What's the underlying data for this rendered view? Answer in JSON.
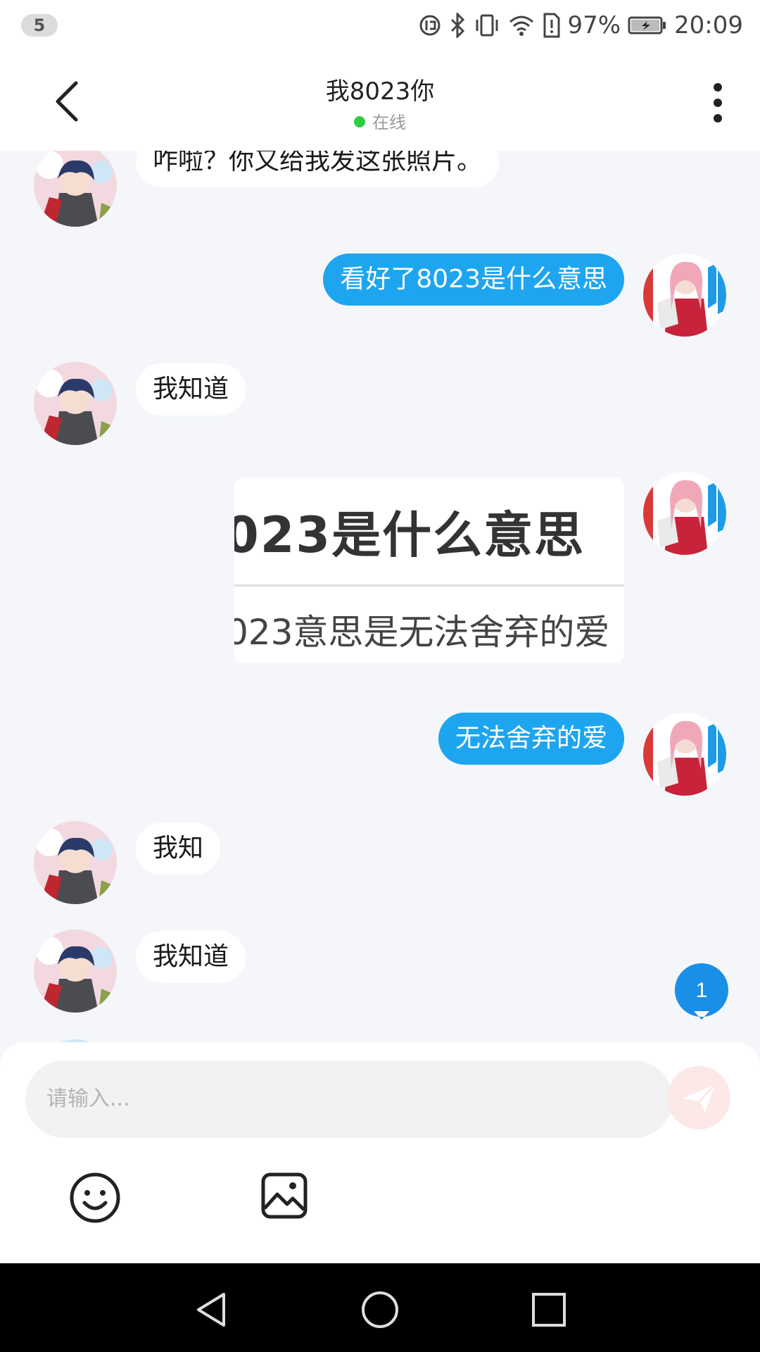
{
  "status_bar": {
    "notification_count": "5",
    "battery_percent": "97%",
    "time": "20:09"
  },
  "header": {
    "title": "我8023你",
    "status": "在线"
  },
  "messages": [
    {
      "side": "left",
      "text": "咋啦？你又给我发这张照片。"
    },
    {
      "side": "right",
      "text": "看好了8023是什么意思"
    },
    {
      "side": "left",
      "text": "我知道"
    },
    {
      "side": "right",
      "image_text_line1": "023是什么意思",
      "image_text_line2": "023意思是无法舍弃的爱"
    },
    {
      "side": "right",
      "text": "无法舍弃的爱"
    },
    {
      "side": "left",
      "text": "我知"
    },
    {
      "side": "left",
      "text": "我知道"
    }
  ],
  "unread_badge": "1",
  "input": {
    "placeholder": "请输入..."
  },
  "toolbar": {
    "icons": [
      "emoji-icon",
      "image-icon"
    ]
  },
  "colors": {
    "bubble_right": "#1ea5f0",
    "bubble_left": "#ffffff",
    "online_dot": "#2ecc40",
    "send_button": "#fde8e8",
    "background": "#f4f6f9"
  }
}
